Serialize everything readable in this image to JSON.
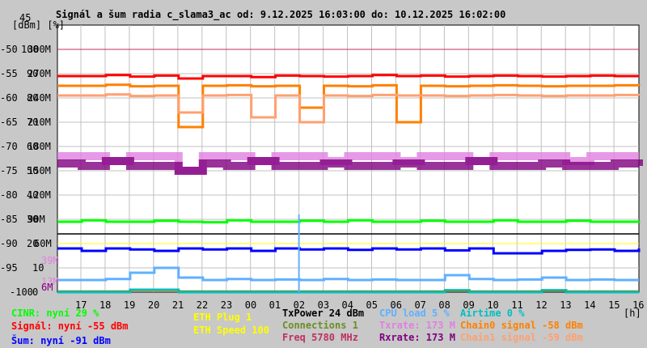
{
  "title": "Signál a šum radia c_slama3_ac od: 9.12.2025 16:03:00 do: 10.12.2025 16:02:00",
  "chart_data": {
    "type": "line",
    "title": "Signál a šum radia c_slama3_ac od: 9.12.2025 16:03:00 do: 10.12.2025 16:02:00",
    "xlabel": "[h]",
    "ylabel_units": [
      "[dBm]",
      "[%]"
    ],
    "ylim": [
      -100,
      -45
    ],
    "top_tick": "45",
    "y_ticks_dbm": [
      "-50",
      "-55",
      "-60",
      "-65",
      "-70",
      "-75",
      "-80",
      "-85",
      "-90",
      "-95",
      "-100"
    ],
    "y_ticks_pct": [
      "100",
      "90",
      "80",
      "70",
      "60",
      "50",
      "40",
      "30",
      "20",
      "10",
      "0"
    ],
    "y_ticks_rate": [
      "300M",
      "270M",
      "240M",
      "210M",
      "180M",
      "150M",
      "120M",
      "90M",
      "60M"
    ],
    "y_ticks_extra": [
      {
        "label": "39M",
        "color": "#e080e0"
      },
      {
        "label": "13M",
        "color": "#e080e0"
      },
      {
        "label": "6M",
        "color": "#800080"
      }
    ],
    "x_ticks": [
      "17",
      "18",
      "19",
      "20",
      "21",
      "22",
      "23",
      "00",
      "01",
      "02",
      "03",
      "04",
      "05",
      "06",
      "07",
      "08",
      "09",
      "10",
      "11",
      "12",
      "13",
      "14",
      "15",
      "16"
    ],
    "grid": true,
    "series": [
      {
        "name": "Signál",
        "color": "#ff0000",
        "values": [
          -55.5,
          -55.5,
          -55.3,
          -55.6,
          -55.4,
          -56,
          -55.5,
          -55.5,
          -55.7,
          -55.4,
          -55.5,
          -55.6,
          -55.5,
          -55.3,
          -55.5,
          -55.4,
          -55.6,
          -55.5,
          -55.4,
          -55.5,
          -55.6,
          -55.5,
          -55.4,
          -55.5,
          -55.5
        ]
      },
      {
        "name": "Chain0 signal",
        "color": "#ff8000",
        "values": [
          -57.5,
          -57.5,
          -57.3,
          -57.6,
          -57.5,
          -66,
          -57.5,
          -57.4,
          -57.6,
          -57.5,
          -62,
          -57.5,
          -57.6,
          -57.4,
          -65,
          -57.5,
          -57.6,
          -57.5,
          -57.4,
          -57.5,
          -57.6,
          -57.5,
          -57.5,
          -57.4,
          -57.5
        ]
      },
      {
        "name": "Chain1 signal",
        "color": "#ffa070",
        "values": [
          -59.5,
          -59.5,
          -59.3,
          -59.6,
          -59.5,
          -63,
          -59.5,
          -59.4,
          -64,
          -59.5,
          -65,
          -59.5,
          -59.6,
          -59.4,
          -59.5,
          -59.5,
          -59.6,
          -59.5,
          -59.4,
          -59.5,
          -59.6,
          -59.5,
          -59.5,
          -59.4,
          -59.5
        ]
      },
      {
        "name": "Txrate",
        "color": "#e080e0",
        "values": [
          -72,
          -72,
          -73,
          -72,
          -72,
          -75,
          -72,
          -72,
          -73,
          -72,
          -72,
          -73,
          -72,
          -72,
          -73,
          -72,
          -72,
          -73,
          -72,
          -72,
          -72,
          -73,
          -72,
          -72,
          -72
        ]
      },
      {
        "name": "Rxrate",
        "color": "#800080",
        "values": [
          -73.5,
          -74,
          -73,
          -74,
          -74,
          -75,
          -73.5,
          -74,
          -73,
          -74,
          -74,
          -73.5,
          -74,
          -74,
          -73.5,
          -74,
          -74,
          -73,
          -74,
          -74,
          -73.5,
          -74,
          -74,
          -73.5,
          -74
        ]
      },
      {
        "name": "CINR",
        "color": "#00ff00",
        "values": [
          -85.5,
          -85.2,
          -85.5,
          -85.5,
          -85.3,
          -85.5,
          -85.6,
          -85.2,
          -85.5,
          -85.5,
          -85.3,
          -85.5,
          -85.2,
          -85.5,
          -85.5,
          -85.3,
          -85.5,
          -85.5,
          -85.2,
          -85.5,
          -85.5,
          -85.3,
          -85.5,
          -85.5,
          -85.4
        ]
      },
      {
        "name": "Šum",
        "color": "#0000ff",
        "values": [
          -91,
          -91.5,
          -91,
          -91.2,
          -91.5,
          -91,
          -91.2,
          -91,
          -91.5,
          -91,
          -91.2,
          -91,
          -91.3,
          -91,
          -91.2,
          -91,
          -91.4,
          -91,
          -92,
          -92,
          -91.5,
          -91.3,
          -91.2,
          -91.5,
          -91
        ]
      },
      {
        "name": "CPU load",
        "color": "#60b0ff",
        "values": [
          -97.5,
          -97.5,
          -97.3,
          -96,
          -95,
          -97,
          -97.5,
          -97.3,
          -97.5,
          -97.4,
          -97.5,
          -97.3,
          -97.5,
          -97.4,
          -97.5,
          -97.5,
          -96.5,
          -97.3,
          -97.5,
          -97.4,
          -97,
          -97.5,
          -97.4,
          -97.5,
          -97.5
        ]
      },
      {
        "name": "Airtime",
        "color": "#00c0c0",
        "values": [
          -100,
          -100,
          -100,
          -99.5,
          -99.5,
          -100,
          -100,
          -100,
          -100,
          -100,
          -100,
          -100,
          -100,
          -100,
          -100,
          -100,
          -99.6,
          -100,
          -100,
          -100,
          -99.6,
          -100,
          -100,
          -100,
          -100
        ]
      },
      {
        "name": "Connections",
        "color": "#6b8e23",
        "values": [
          -99.7,
          -99.7,
          -99.7,
          -99.7,
          -99.7,
          -99.7,
          -99.7,
          -99.7,
          -99.7,
          -99.7,
          -99.7,
          -99.7,
          -99.7,
          -99.7,
          -99.7,
          -99.7,
          -99.7,
          -99.7,
          -99.7,
          -99.7,
          -99.7,
          -99.7,
          -99.7,
          -99.7,
          -99.7
        ]
      },
      {
        "name": "Freq",
        "color": "#c03060",
        "values": [
          -50,
          -50,
          -50,
          -50,
          -50,
          -50,
          -50,
          -50,
          -50,
          -50,
          -50,
          -50,
          -50,
          -50,
          -50,
          -50,
          -50,
          -50,
          -50,
          -50,
          -50,
          -50,
          -50,
          -50,
          -50
        ]
      },
      {
        "name": "ETH",
        "color": "#ffff00",
        "values": [
          -90,
          -90,
          -90,
          -90,
          -90,
          -90,
          -90,
          -90,
          -90,
          -90,
          -90,
          -90,
          -90,
          -90,
          -90,
          -90,
          -90,
          -90,
          -90,
          -90,
          -90,
          -90,
          -90,
          -90,
          -90
        ]
      }
    ],
    "reference_line_dbm": -88,
    "spikes": [
      {
        "hour": "02",
        "series": "CPU load",
        "value": -84
      }
    ]
  },
  "legend": {
    "cinr": "CINR: nyní 29 %",
    "signal": "Signál: nyní -55 dBm",
    "noise": "Šum: nyní -91 dBm",
    "eth_plug": "ETH Plug 1",
    "eth_speed": "ETH Speed 100",
    "txpower": "TxPower 24 dBm",
    "connections": "Connections 1",
    "freq": "Freq 5780 MHz",
    "cpu": "CPU load 5 %",
    "txrate": "Txrate: 173 M",
    "rxrate": "Rxrate: 173 M",
    "airtime": "Airtime 0 %",
    "chain0": "Chain0 signal -58 dBm",
    "chain1": "Chain1 signal -59 dBm"
  }
}
